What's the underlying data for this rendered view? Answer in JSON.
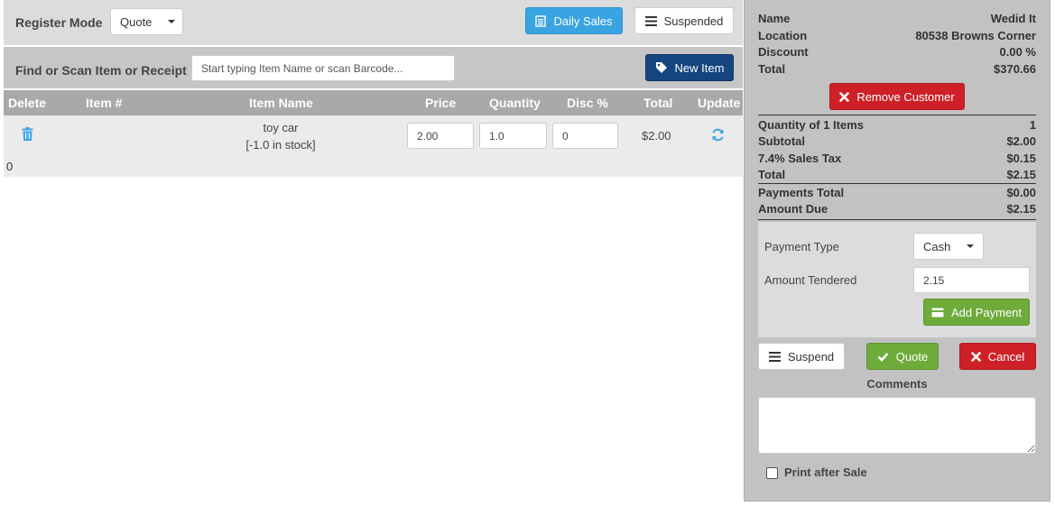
{
  "top_bar": {
    "register_mode_label": "Register Mode",
    "mode_value": "Quote",
    "daily_sales_label": "Daily Sales",
    "suspended_label": "Suspended"
  },
  "search_bar": {
    "label": "Find or Scan Item or Receipt",
    "placeholder": "Start typing Item Name or scan Barcode...",
    "new_item_label": "New Item"
  },
  "cart_table": {
    "columns": [
      "Delete",
      "Item #",
      "Item Name",
      "Price",
      "Quantity",
      "Disc %",
      "Total",
      "Update"
    ],
    "rows": [
      {
        "item_number": "",
        "item_name": "toy car",
        "stock": "[-1.0 in stock]",
        "price": "2.00",
        "quantity": "1.0",
        "discount": "0",
        "total": "$2.00"
      }
    ],
    "footer_text": "0"
  },
  "customer": {
    "name_label": "Name",
    "name_value": "Wedid It",
    "location_label": "Location",
    "location_value": "80538 Browns Corner",
    "discount_label": "Discount",
    "discount_value": "0.00 %",
    "total_label": "Total",
    "total_value": "$370.66",
    "remove_label": "Remove Customer"
  },
  "summary": {
    "quantity_label": "Quantity of 1 Items",
    "quantity_value": "1",
    "subtotal_label": "Subtotal",
    "subtotal_value": "$2.00",
    "tax_label": "7.4% Sales Tax",
    "tax_value": "$0.15",
    "total_label": "Total",
    "total_value": "$2.15",
    "payments_total_label": "Payments Total",
    "payments_total_value": "$0.00",
    "amount_due_label": "Amount Due",
    "amount_due_value": "$2.15"
  },
  "payment": {
    "type_label": "Payment Type",
    "type_value": "Cash",
    "tendered_label": "Amount Tendered",
    "tendered_value": "2.15",
    "add_payment_label": "Add Payment"
  },
  "actions": {
    "suspend_label": "Suspend",
    "quote_label": "Quote",
    "cancel_label": "Cancel"
  },
  "comments": {
    "label": "Comments",
    "value": ""
  },
  "print_after_sale_label": "Print after Sale",
  "colors": {
    "table_header": "#a9a9a9",
    "panel_gray": "#c2c2c2",
    "blue": "#3aa4e3",
    "navy": "#14457e",
    "red": "#cf2027",
    "green": "#6eab3b"
  }
}
